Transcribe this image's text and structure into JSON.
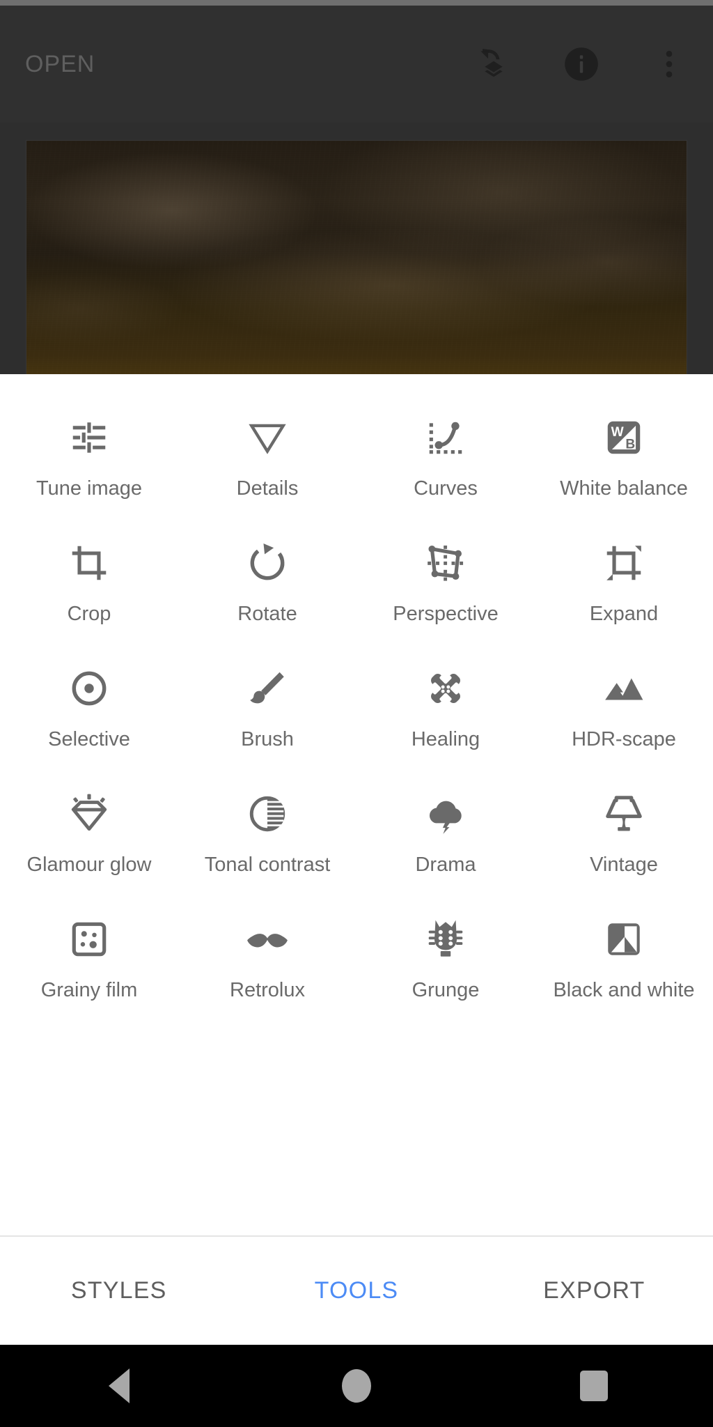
{
  "app": {
    "title": "Snapseed",
    "accent_color": "#4c8bf5",
    "icon_color": "#6a6a6a",
    "sheet_background": "#ffffff",
    "editor_background": "#2e2e2e"
  },
  "appbar": {
    "open_label": "OPEN",
    "actions": [
      {
        "name": "undo-stack-icon",
        "label": "Undo / edit stack"
      },
      {
        "name": "info-icon",
        "label": "Info"
      },
      {
        "name": "overflow-menu-icon",
        "label": "More options"
      }
    ]
  },
  "preview": {
    "description": "Dark brown sepia night sky with clouds",
    "dominant_colors": [
      "#241d14",
      "#2b2318",
      "#3b2c10",
      "#44330f"
    ]
  },
  "tools": {
    "columns": 4,
    "items": [
      {
        "label": "Tune image",
        "icon": "sliders-icon"
      },
      {
        "label": "Details",
        "icon": "triangle-down-icon"
      },
      {
        "label": "Curves",
        "icon": "curves-icon"
      },
      {
        "label": "White balance",
        "icon": "white-balance-icon",
        "icon_text": [
          "W",
          "B"
        ]
      },
      {
        "label": "Crop",
        "icon": "crop-icon"
      },
      {
        "label": "Rotate",
        "icon": "rotate-icon"
      },
      {
        "label": "Perspective",
        "icon": "perspective-icon"
      },
      {
        "label": "Expand",
        "icon": "expand-icon"
      },
      {
        "label": "Selective",
        "icon": "selective-target-icon"
      },
      {
        "label": "Brush",
        "icon": "paintbrush-icon"
      },
      {
        "label": "Healing",
        "icon": "bandage-cross-icon"
      },
      {
        "label": "HDR-scape",
        "icon": "mountains-icon"
      },
      {
        "label": "Glamour glow",
        "icon": "gem-sparkle-icon"
      },
      {
        "label": "Tonal contrast",
        "icon": "contrast-circle-icon"
      },
      {
        "label": "Drama",
        "icon": "storm-cloud-icon"
      },
      {
        "label": "Vintage",
        "icon": "table-lamp-icon"
      },
      {
        "label": "Grainy film",
        "icon": "grain-dots-icon"
      },
      {
        "label": "Retrolux",
        "icon": "mustache-icon"
      },
      {
        "label": "Grunge",
        "icon": "guitar-headstock-icon"
      },
      {
        "label": "Black and white",
        "icon": "bw-square-icon"
      }
    ]
  },
  "tabs": [
    {
      "label": "STYLES",
      "active": false
    },
    {
      "label": "TOOLS",
      "active": true
    },
    {
      "label": "EXPORT",
      "active": false
    }
  ],
  "navbar": [
    {
      "label": "Back",
      "icon": "back-triangle-icon"
    },
    {
      "label": "Home",
      "icon": "home-circle-icon"
    },
    {
      "label": "Recents",
      "icon": "recents-square-icon"
    }
  ]
}
